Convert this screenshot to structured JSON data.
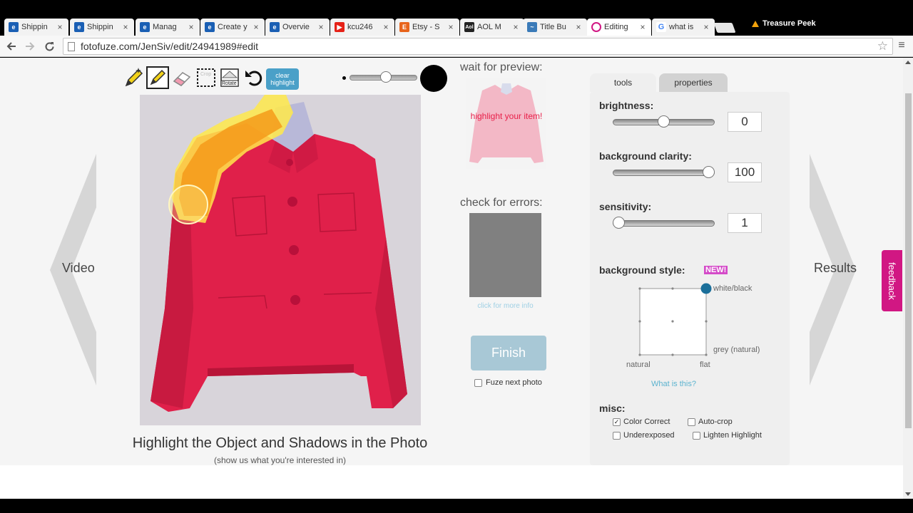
{
  "browser": {
    "tabs": [
      {
        "title": "Shippin",
        "icon": "ebay-icon",
        "color": "#1a5fb4"
      },
      {
        "title": "Shippin",
        "icon": "ebay-icon",
        "color": "#1a5fb4"
      },
      {
        "title": "Manag",
        "icon": "ebay-icon",
        "color": "#1a5fb4"
      },
      {
        "title": "Create y",
        "icon": "ebay-icon",
        "color": "#1a5fb4"
      },
      {
        "title": "Overvie",
        "icon": "ebay-icon",
        "color": "#1a5fb4"
      },
      {
        "title": "kcu246",
        "icon": "youtube-icon",
        "color": "#e62117"
      },
      {
        "title": "Etsy - S",
        "icon": "etsy-icon",
        "color": "#e8641b"
      },
      {
        "title": "AOL M",
        "icon": "aol-icon",
        "color": "#222222"
      },
      {
        "title": "Title Bu",
        "icon": "title-builder-icon",
        "color": "#3a7ab8"
      },
      {
        "title": "Editing",
        "icon": "fotofuze-icon",
        "color": "#d11783"
      },
      {
        "title": "what is",
        "icon": "google-icon",
        "color": "#4285f4"
      }
    ],
    "extension_label": "Treasure Peek",
    "url": "fotofuze.com/JenSiv/edit/24941989#edit"
  },
  "editor": {
    "clear_highlight_label": "clear highlight",
    "crop_label": "Crop",
    "rotate_label": "Rotate",
    "brush_size_fraction": 0.55,
    "nav_left_label": "Video",
    "nav_right_label": "Results",
    "caption": "Highlight the Object and Shadows in the Photo",
    "subcaption": "(show us what you're interested in)"
  },
  "preview": {
    "wait_label": "wait for preview:",
    "overlay_text": "highlight your item!",
    "errors_label": "check for errors:",
    "more_info_link": "click for more info",
    "finish_label": "Finish",
    "fuze_next_label": "Fuze next photo",
    "fuze_next_checked": false
  },
  "panel": {
    "tabs": {
      "tools": "tools",
      "properties": "properties"
    },
    "brightness": {
      "label": "brightness:",
      "value": "0",
      "fraction": 0.5
    },
    "background_clarity": {
      "label": "background clarity:",
      "value": "100",
      "fraction": 1.0
    },
    "sensitivity": {
      "label": "sensitivity:",
      "value": "1",
      "fraction": 0.0
    },
    "background_style": {
      "label": "background style:",
      "badge": "NEW!",
      "corner_white_black": "white/black",
      "corner_grey": "grey (natural)",
      "corner_natural": "natural",
      "corner_flat": "flat",
      "what_is_this": "What is this?"
    },
    "misc": {
      "label": "misc:",
      "options": [
        {
          "label": "Color Correct",
          "checked": true
        },
        {
          "label": "Auto-crop",
          "checked": false
        },
        {
          "label": "Underexposed",
          "checked": false
        },
        {
          "label": "Lighten Highlight",
          "checked": false
        }
      ]
    }
  },
  "feedback_label": "feedback",
  "colors": {
    "accent_blue": "#4aa0c8",
    "finish_button": "#a8c8d6",
    "feedback": "#d11783",
    "jacket": "#e0204a",
    "highlight_yellow": "#ffe94a",
    "highlight_orange": "#f59a1a"
  }
}
